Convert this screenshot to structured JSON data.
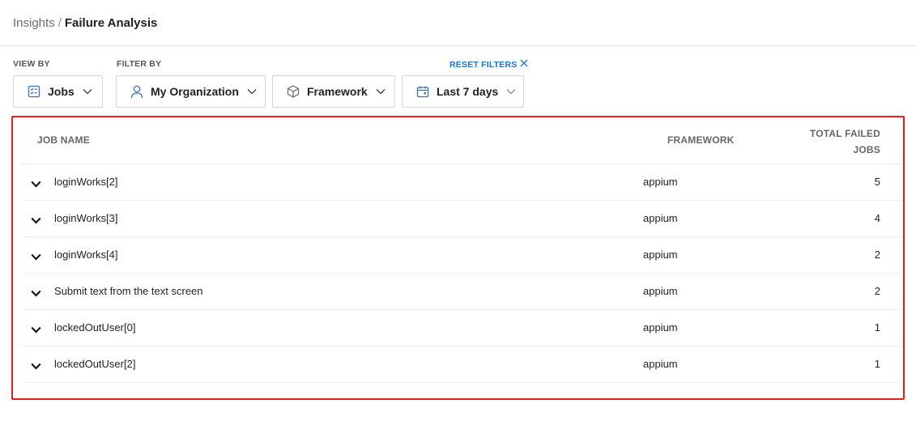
{
  "breadcrumb": {
    "parent": "Insights",
    "separator": "/",
    "current": "Failure Analysis"
  },
  "filters": {
    "view_by_label": "VIEW BY",
    "filter_by_label": "FILTER BY",
    "reset_label": "RESET FILTERS",
    "view_by": {
      "value": "Jobs",
      "icon": "list-icon"
    },
    "organization": {
      "value": "My Organization",
      "icon": "user-icon"
    },
    "framework": {
      "value": "Framework",
      "icon": "cube-icon"
    },
    "date_range": {
      "value": "Last 7 days",
      "icon": "calendar-icon"
    }
  },
  "table": {
    "columns": {
      "job_name": "JOB NAME",
      "framework": "FRAMEWORK",
      "total_failed_line1": "TOTAL FAILED",
      "total_failed_line2": "JOBS"
    },
    "rows": [
      {
        "name": "loginWorks[2]",
        "framework": "appium",
        "total": "5"
      },
      {
        "name": "loginWorks[3]",
        "framework": "appium",
        "total": "4"
      },
      {
        "name": "loginWorks[4]",
        "framework": "appium",
        "total": "2"
      },
      {
        "name": "Submit text from the text screen",
        "framework": "appium",
        "total": "2"
      },
      {
        "name": "lockedOutUser[0]",
        "framework": "appium",
        "total": "1"
      },
      {
        "name": "lockedOutUser[2]",
        "framework": "appium",
        "total": "1"
      }
    ]
  },
  "colors": {
    "accent": "#1a73d6",
    "highlight": "#ea1c1c",
    "icon_blue": "#3d6fb8"
  }
}
